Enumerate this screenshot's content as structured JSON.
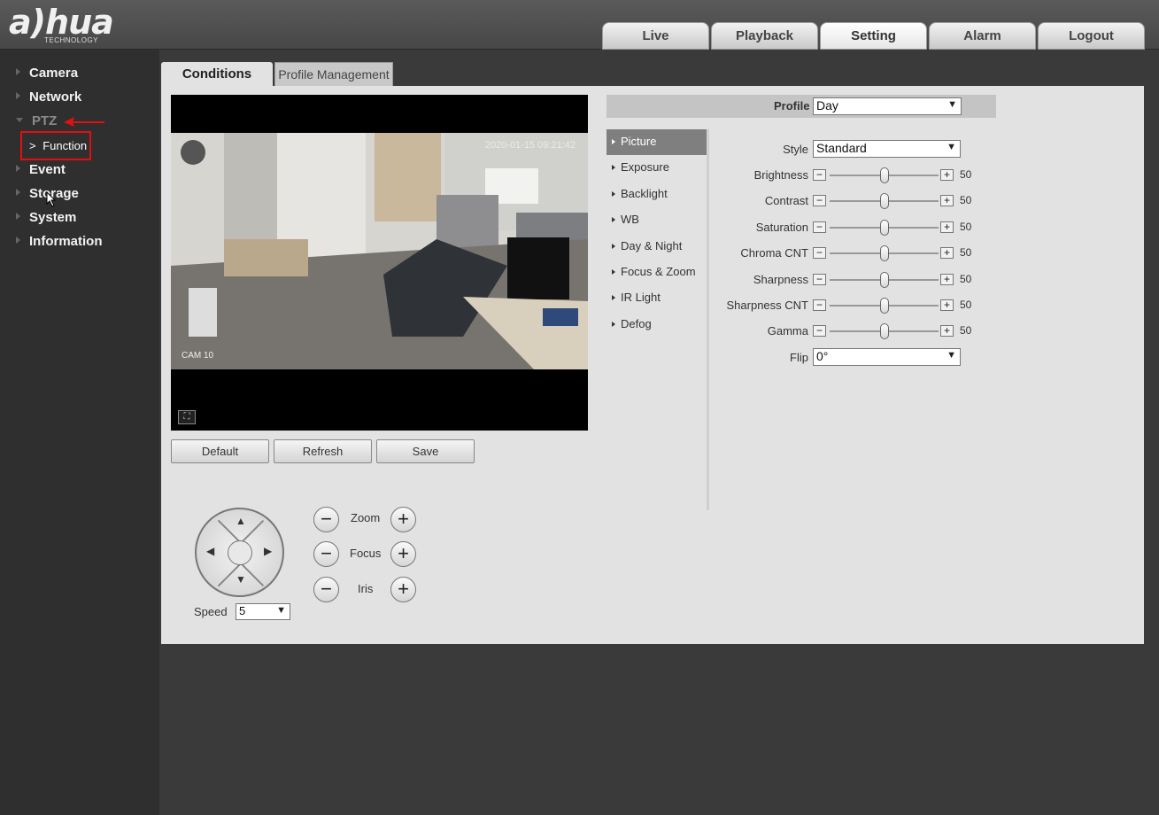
{
  "header": {
    "logo_text": "a)hua",
    "logo_sub": "TECHNOLOGY",
    "tabs": [
      {
        "label": "Live"
      },
      {
        "label": "Playback"
      },
      {
        "label": "Setting"
      },
      {
        "label": "Alarm"
      },
      {
        "label": "Logout"
      }
    ],
    "active_tab": "Setting"
  },
  "sidebar": {
    "items": [
      {
        "label": "Camera"
      },
      {
        "label": "Network"
      },
      {
        "label": "PTZ"
      },
      {
        "label": "Event"
      },
      {
        "label": "Storage"
      },
      {
        "label": "System"
      },
      {
        "label": "Information"
      }
    ],
    "sub_item": {
      "label": "Function"
    }
  },
  "content": {
    "tabs": [
      {
        "label": "Conditions"
      },
      {
        "label": "Profile Management"
      }
    ],
    "video": {
      "cam_label": "CAM 10",
      "timestamp": "2020-01-15 09:21:42"
    },
    "buttons": {
      "default": "Default",
      "refresh": "Refresh",
      "save": "Save"
    },
    "ptz": {
      "speed_label": "Speed",
      "speed_value": "5",
      "zoom_label": "Zoom",
      "focus_label": "Focus",
      "iris_label": "Iris"
    },
    "profile": {
      "label": "Profile",
      "value": "Day"
    },
    "menu": [
      {
        "label": "Picture"
      },
      {
        "label": "Exposure"
      },
      {
        "label": "Backlight"
      },
      {
        "label": "WB"
      },
      {
        "label": "Day & Night"
      },
      {
        "label": "Focus & Zoom"
      },
      {
        "label": "IR Light"
      },
      {
        "label": "Defog"
      }
    ],
    "settings": {
      "style": {
        "label": "Style",
        "value": "Standard"
      },
      "sliders": [
        {
          "label": "Brightness",
          "value": "50"
        },
        {
          "label": "Contrast",
          "value": "50"
        },
        {
          "label": "Saturation",
          "value": "50"
        },
        {
          "label": "Chroma CNT",
          "value": "50"
        },
        {
          "label": "Sharpness",
          "value": "50"
        },
        {
          "label": "Sharpness CNT",
          "value": "50"
        },
        {
          "label": "Gamma",
          "value": "50"
        }
      ],
      "flip": {
        "label": "Flip",
        "value": "0°"
      }
    }
  },
  "colors": {
    "highlight_red": "#e01010",
    "sidebar_bg": "#2f2f2f",
    "active_menu": "#7f7f7f"
  }
}
